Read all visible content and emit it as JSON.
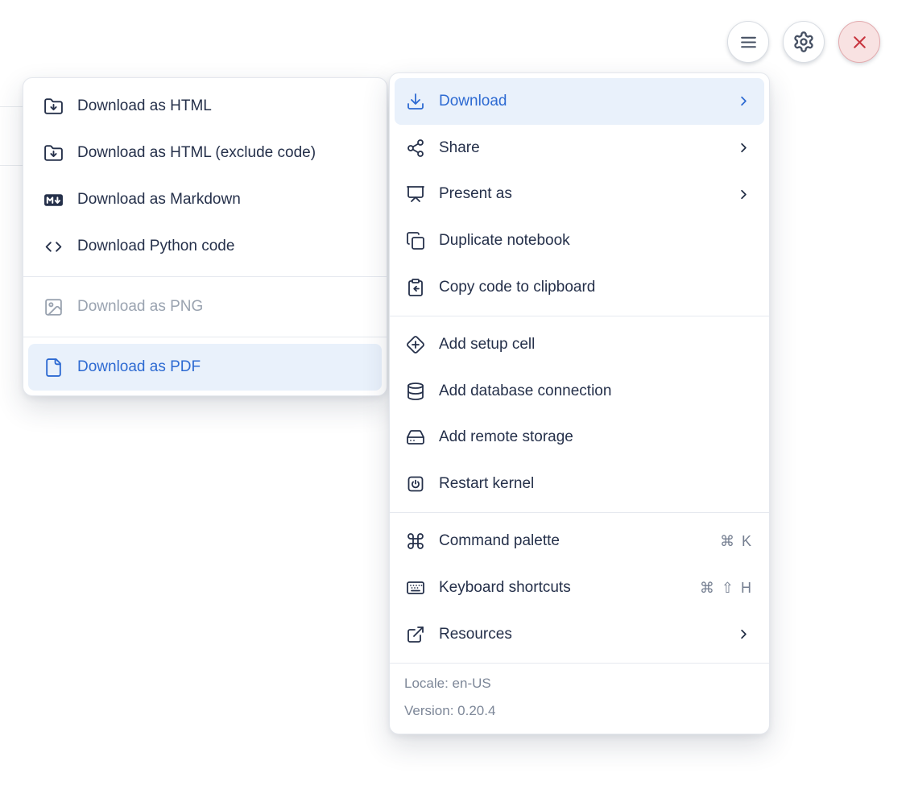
{
  "toolbar": {
    "buttons": [
      {
        "name": "notebook-actions-menu",
        "icon": "hamburger-icon"
      },
      {
        "name": "settings",
        "icon": "gear-icon"
      },
      {
        "name": "shutdown",
        "icon": "x-icon",
        "variant": "danger"
      }
    ]
  },
  "download_submenu": {
    "groups": [
      {
        "items": [
          {
            "label": "Download as HTML",
            "icon": "folder-down-icon"
          },
          {
            "label": "Download as HTML (exclude code)",
            "icon": "folder-down-icon"
          },
          {
            "label": "Download as Markdown",
            "icon": "markdown-icon"
          },
          {
            "label": "Download Python code",
            "icon": "code-icon"
          }
        ]
      },
      {
        "items": [
          {
            "label": "Download as PNG",
            "icon": "image-icon",
            "state": "disabled"
          }
        ]
      },
      {
        "items": [
          {
            "label": "Download as PDF",
            "icon": "file-icon",
            "state": "highlighted"
          }
        ]
      }
    ]
  },
  "main_menu": {
    "groups": [
      {
        "items": [
          {
            "label": "Download",
            "icon": "download-icon",
            "trailing_icon": "chevron-right-icon",
            "state": "highlighted"
          },
          {
            "label": "Share",
            "icon": "share-icon",
            "trailing_icon": "chevron-right-icon"
          },
          {
            "label": "Present as",
            "icon": "present-icon",
            "trailing_icon": "chevron-right-icon"
          },
          {
            "label": "Duplicate notebook",
            "icon": "duplicate-icon"
          },
          {
            "label": "Copy code to clipboard",
            "icon": "clipboard-copy-icon"
          }
        ]
      },
      {
        "items": [
          {
            "label": "Add setup cell",
            "icon": "diamond-plus-icon"
          },
          {
            "label": "Add database connection",
            "icon": "database-icon"
          },
          {
            "label": "Add remote storage",
            "icon": "hard-drive-icon"
          },
          {
            "label": "Restart kernel",
            "icon": "power-icon"
          }
        ]
      },
      {
        "items": [
          {
            "label": "Command palette",
            "icon": "command-icon",
            "shortcut": [
              "⌘",
              "K"
            ]
          },
          {
            "label": "Keyboard shortcuts",
            "icon": "keyboard-icon",
            "shortcut": [
              "⌘",
              "⇧",
              "H"
            ]
          },
          {
            "label": "Resources",
            "icon": "external-link-icon",
            "trailing_icon": "chevron-right-icon"
          }
        ]
      }
    ],
    "footer": {
      "locale": "Locale: en-US",
      "version": "Version: 0.20.4"
    }
  },
  "colors": {
    "accent": "#2d6ad2",
    "accent_bg": "#e9f1fb",
    "text": "#25304a",
    "muted": "#7d8798",
    "disabled": "#9aa3b0",
    "shortcut": "#747e90",
    "divider": "#e6e9ef",
    "panel_border": "#e4e7ed",
    "danger": "#c8353f",
    "danger_bg": "#f8e2e2",
    "danger_border": "#e3abae"
  }
}
